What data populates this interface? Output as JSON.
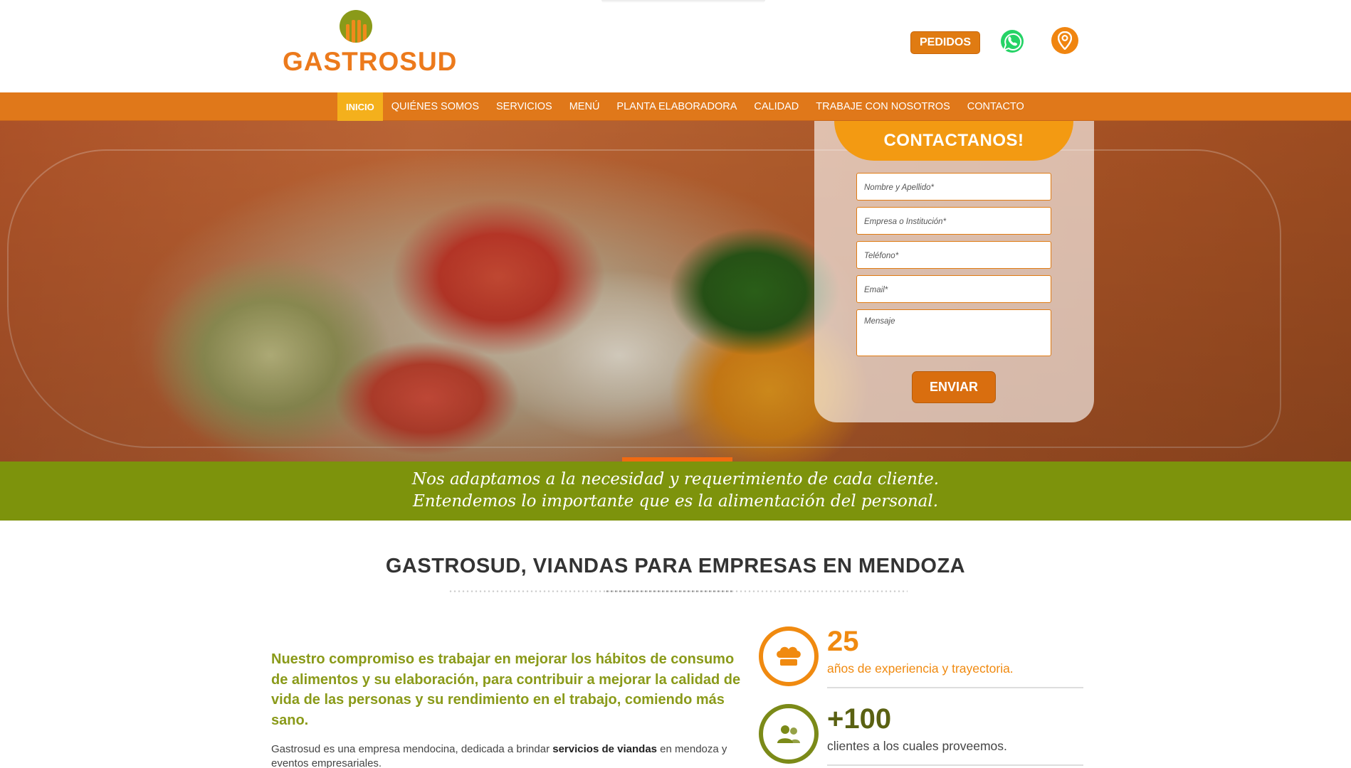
{
  "brand": {
    "name": "GASTROSUD",
    "orange": "#e0781a",
    "green": "#7d930c"
  },
  "header": {
    "pedidos_label": "PEDIDOS",
    "whatsapp_icon": "whatsapp-icon",
    "location_icon": "map-pin-icon"
  },
  "nav": {
    "items": [
      {
        "label": "INICIO",
        "active": true
      },
      {
        "label": "QUIÉNES SOMOS",
        "active": false
      },
      {
        "label": "SERVICIOS",
        "active": false
      },
      {
        "label": "MENÚ",
        "active": false
      },
      {
        "label": "PLANTA ELABORADORA",
        "active": false
      },
      {
        "label": "CALIDAD",
        "active": false
      },
      {
        "label": "TRABAJE CON NOSOTROS",
        "active": false
      },
      {
        "label": "CONTACTO",
        "active": false
      }
    ]
  },
  "contact": {
    "title": "CONTACTANOS!",
    "fields": {
      "name": "Nombre y Apellido*",
      "company": "Empresa o Institución*",
      "phone": "Teléfono*",
      "email": "Email*",
      "message": "Mensaje"
    },
    "submit": "ENVIAR"
  },
  "band": {
    "line1": "Nos adaptamos a la necesidad y requerimiento de cada cliente.",
    "line2": "Entendemos lo importante que es la alimentación del personal."
  },
  "section": {
    "title": "GASTROSUD, VIANDAS PARA EMPRESAS EN MENDOZA",
    "lead": "Nuestro compromiso es trabajar en mejorar los hábitos de consumo de alimentos y su elaboración, para contribuir a mejorar la calidad de vida de las personas y su rendimiento en el trabajo, comiendo más sano.",
    "body_prefix": "Gastrosud es una empresa mendocina, dedicada a brindar ",
    "body_bold": "servicios de viandas",
    "body_suffix": " en mendoza y eventos empresariales."
  },
  "stats": [
    {
      "number": "25",
      "text": "años de experiencia y trayectoria.",
      "icon": "chef-hat-icon",
      "color": "#f08a10"
    },
    {
      "number": "+100",
      "text": "clientes a los cuales proveemos.",
      "icon": "users-icon",
      "color": "#7b8a18"
    }
  ]
}
